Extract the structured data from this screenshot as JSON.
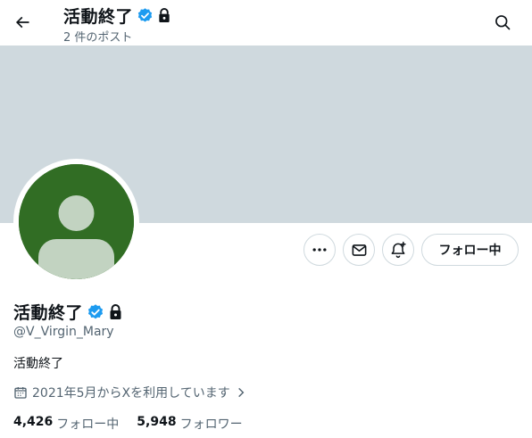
{
  "header": {
    "name": "活動終了",
    "post_count": "2 件のポスト"
  },
  "profile": {
    "display_name": "活動終了",
    "handle": "@V_Virgin_Mary",
    "bio": "活動終了",
    "joined": "2021年5月からXを利用しています",
    "verified": true,
    "protected": true,
    "banner_color": "#cfd9de",
    "avatar_color": "#316d24"
  },
  "actions": {
    "more_icon": "more-icon",
    "message_icon": "message-icon",
    "notify_icon": "notification-bell-icon",
    "follow_label": "フォロー中"
  },
  "stats": {
    "following_count": "4,426",
    "following_label": "フォロー中",
    "followers_count": "5,948",
    "followers_label": "フォロワー"
  },
  "colors": {
    "verified": "#1d9bf0",
    "secondary_text": "#536471",
    "primary_text": "#0f1419"
  }
}
